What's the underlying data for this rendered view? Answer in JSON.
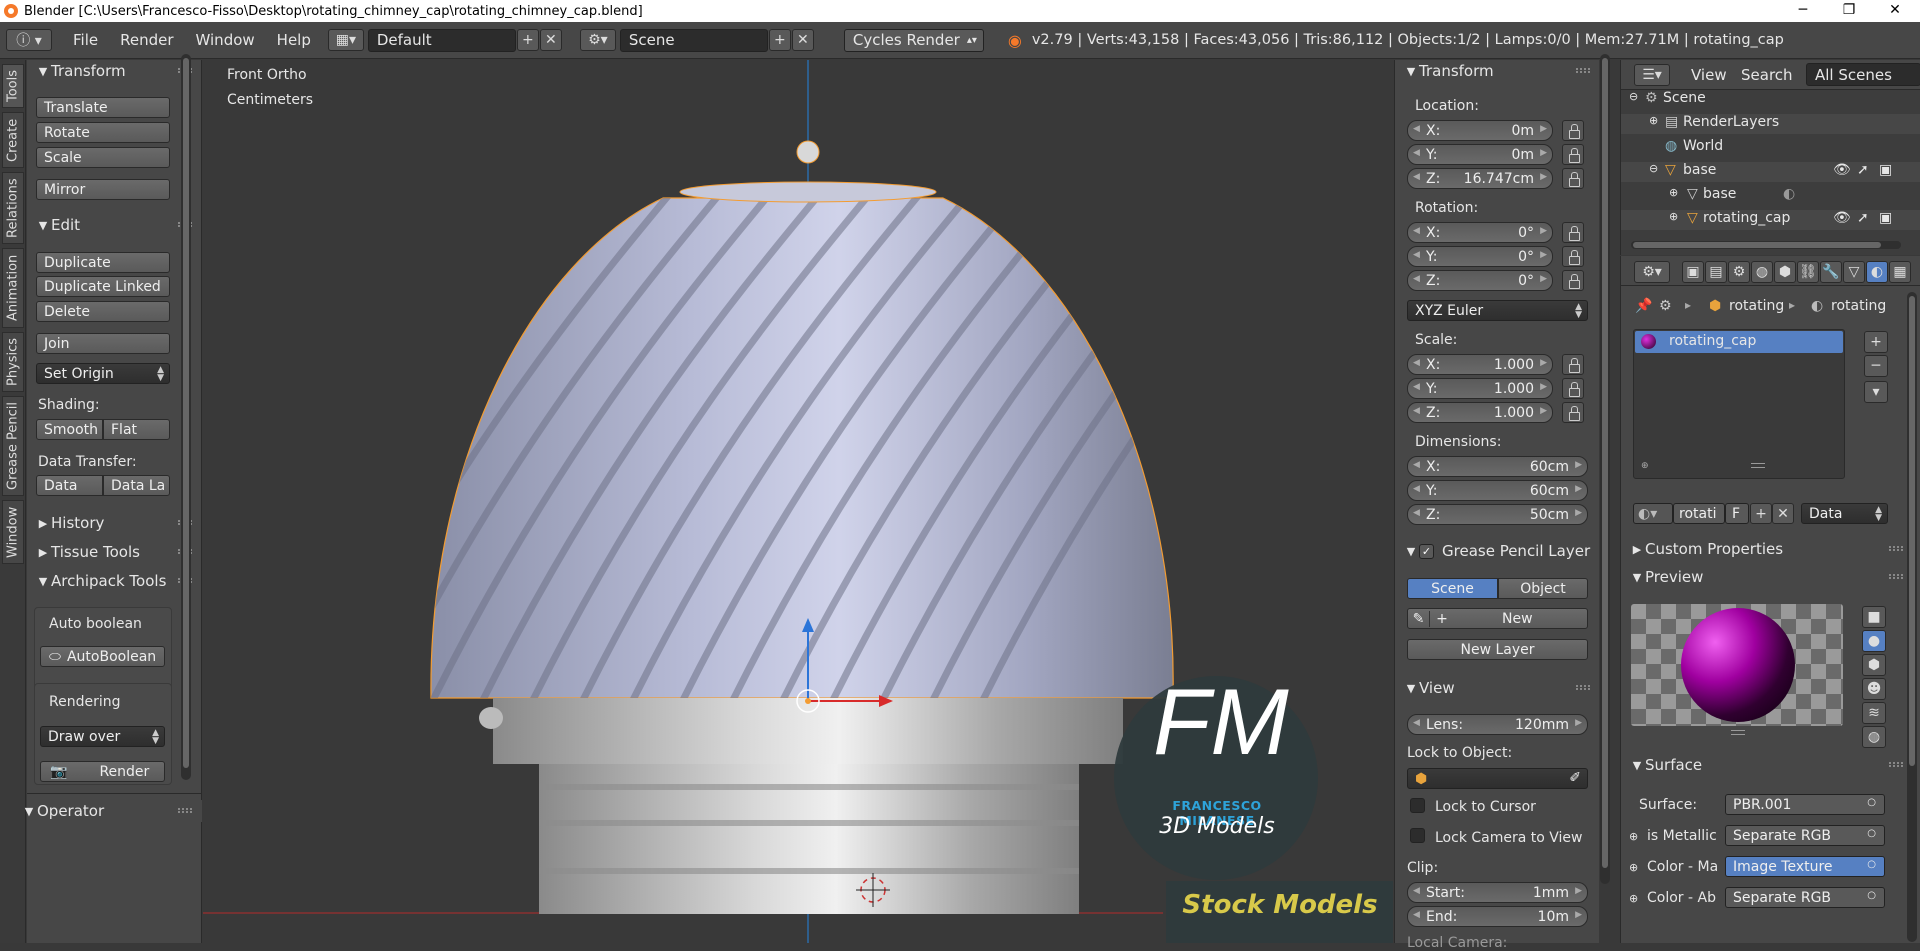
{
  "window": {
    "title": "Blender [C:\\Users\\Francesco-Fisso\\Desktop\\rotating_chimney_cap\\rotating_chimney_cap.blend]",
    "minimize": "─",
    "maximize": "❐",
    "close": "✕"
  },
  "menubar": {
    "items": [
      "File",
      "Render",
      "Window",
      "Help"
    ],
    "layout": "Default",
    "scene": "Scene",
    "engine": "Cycles Render",
    "stats": "v2.79 | Verts:43,158 | Faces:43,056 | Tris:86,112 | Objects:1/2 | Lamps:0/0 | Mem:27.71M | rotating_cap"
  },
  "left_tabs": [
    "Tools",
    "Create",
    "Relations",
    "Animation",
    "Physics",
    "Grease Pencil",
    "Window"
  ],
  "toolshelf": {
    "transform": {
      "title": "Transform",
      "buttons": [
        "Translate",
        "Rotate",
        "Scale",
        "Mirror"
      ]
    },
    "edit": {
      "title": "Edit",
      "buttons": [
        "Duplicate",
        "Duplicate Linked",
        "Delete",
        "Join"
      ],
      "set_origin": "Set Origin"
    },
    "shading": {
      "label": "Shading:",
      "smooth": "Smooth",
      "flat": "Flat"
    },
    "data_transfer": {
      "label": "Data Transfer:",
      "data": "Data",
      "data_la": "Data La"
    },
    "history": "History",
    "tissue": "Tissue Tools",
    "archipack": "Archipack Tools",
    "auto_boolean_label": "Auto boolean",
    "auto_boolean_btn": "AutoBoolean",
    "rendering_label": "Rendering",
    "draw_over": "Draw over",
    "render_btn": "Render",
    "operator": "Operator"
  },
  "viewport": {
    "view_name": "Front Ortho",
    "units": "Centimeters",
    "watermark": {
      "letters": "FM",
      "name": "FRANCESCO MILANESE",
      "sub": "3D Models",
      "stock": "Stock Models"
    }
  },
  "npanel": {
    "transform_title": "Transform",
    "location_label": "Location:",
    "location": [
      {
        "k": "X:",
        "v": "0m"
      },
      {
        "k": "Y:",
        "v": "0m"
      },
      {
        "k": "Z:",
        "v": "16.747cm"
      }
    ],
    "rotation_label": "Rotation:",
    "rotation": [
      {
        "k": "X:",
        "v": "0°"
      },
      {
        "k": "Y:",
        "v": "0°"
      },
      {
        "k": "Z:",
        "v": "0°"
      }
    ],
    "rotation_mode": "XYZ Euler",
    "scale_label": "Scale:",
    "scale": [
      {
        "k": "X:",
        "v": "1.000"
      },
      {
        "k": "Y:",
        "v": "1.000"
      },
      {
        "k": "Z:",
        "v": "1.000"
      }
    ],
    "dimensions_label": "Dimensions:",
    "dimensions": [
      {
        "k": "X:",
        "v": "60cm"
      },
      {
        "k": "Y:",
        "v": "60cm"
      },
      {
        "k": "Z:",
        "v": "50cm"
      }
    ],
    "gp_title": "Grease Pencil Layer",
    "gp_scene": "Scene",
    "gp_object": "Object",
    "gp_new": "New",
    "gp_new_layer": "New Layer",
    "view_title": "View",
    "lens_k": "Lens:",
    "lens_v": "120mm",
    "lock_to_object": "Lock to Object:",
    "lock_cursor": "Lock to Cursor",
    "lock_camera": "Lock Camera to View",
    "clip_label": "Clip:",
    "clip_start_k": "Start:",
    "clip_start_v": "1mm",
    "clip_end_k": "End:",
    "clip_end_v": "10m",
    "local_camera": "Local Camera:"
  },
  "outliner": {
    "view": "View",
    "search": "Search",
    "all_scenes": "All Scenes",
    "items": [
      "Scene",
      "RenderLayers",
      "World",
      "base",
      "base",
      "rotating_cap"
    ]
  },
  "properties": {
    "crumb1": "rotating",
    "crumb2": "rotating",
    "material_slot": "rotating_cap",
    "mat_name": "rotati",
    "mat_f": "F",
    "data": "Data",
    "custom_props": "Custom Properties",
    "preview": "Preview",
    "surface_title": "Surface",
    "surface_label": "Surface:",
    "surface_value": "PBR.001",
    "rows": [
      {
        "label": "is Metallic",
        "value": "Separate RGB"
      },
      {
        "label": "Color - Ma",
        "value": "Image Texture"
      },
      {
        "label": "Color - Ab",
        "value": "Separate RGB"
      }
    ]
  },
  "colors": {
    "accent": "#5680c2",
    "panel": "#474747",
    "viewport": "#393939",
    "selection_outline": "#f39c32"
  }
}
